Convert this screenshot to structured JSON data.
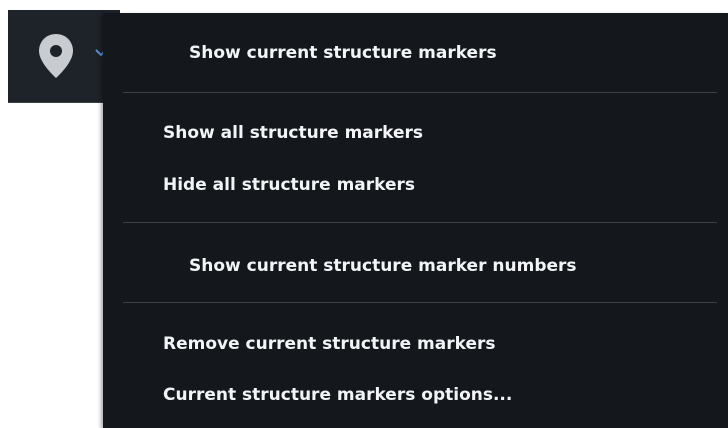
{
  "toolbar": {
    "button_icon": "map-pin-icon",
    "dropdown_icon": "chevron-down-icon"
  },
  "menu": {
    "items": [
      {
        "label": "Show current structure markers"
      },
      {
        "label": "Show all structure markers"
      },
      {
        "label": "Hide all structure markers"
      },
      {
        "label": "Show current structure marker numbers"
      },
      {
        "label": "Remove current structure markers"
      },
      {
        "label": "Current structure markers options..."
      }
    ]
  },
  "colors": {
    "menu_background": "#14181d",
    "toolbar_background": "#1e2329",
    "separator": "#3b4149",
    "text": "#f2f4f6"
  }
}
